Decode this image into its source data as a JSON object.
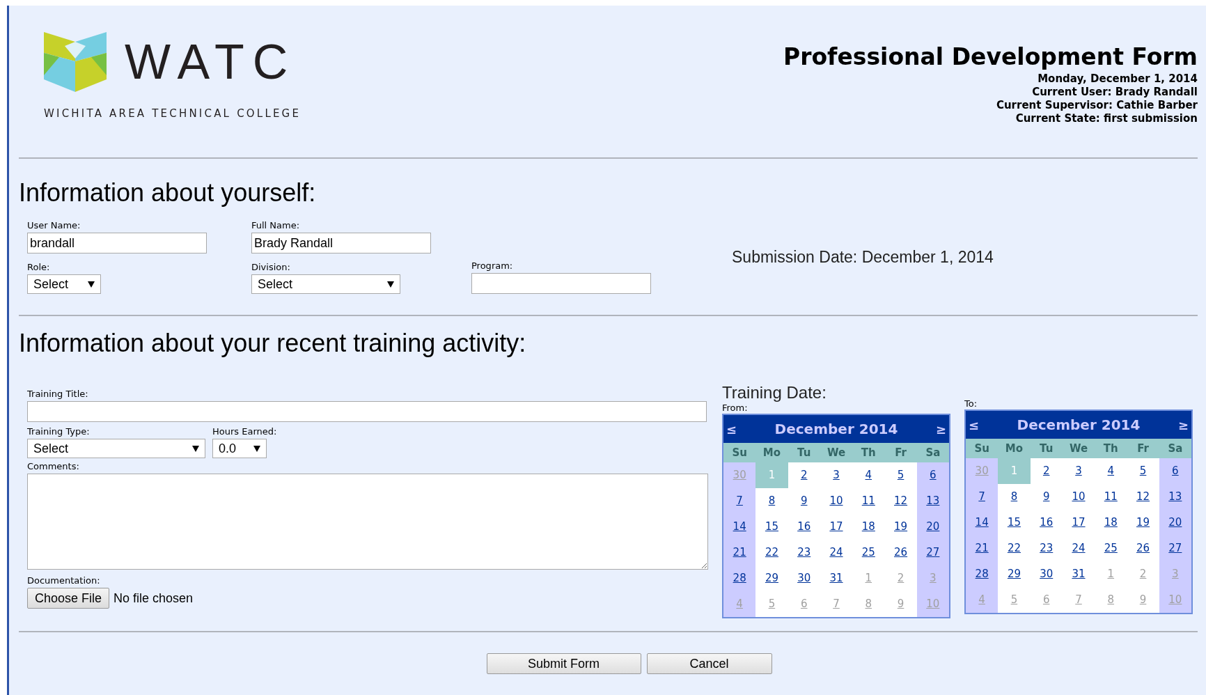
{
  "logo": {
    "wordmark": "WATC",
    "tagline": "WICHITA AREA TECHNICAL COLLEGE"
  },
  "header": {
    "title": "Professional Development Form",
    "lines": [
      "Monday, December 1, 2014",
      "Current User: Brady Randall",
      "Current Supervisor: Cathie Barber",
      "Current State: first submission"
    ]
  },
  "section_1": {
    "heading": "Information about yourself:",
    "user_name": {
      "label": "User Name:",
      "value": "brandall"
    },
    "full_name": {
      "label": "Full Name:",
      "value": "Brady Randall"
    },
    "role": {
      "label": "Role:",
      "value": "Select"
    },
    "division": {
      "label": "Division:",
      "value": "Select"
    },
    "program": {
      "label": "Program:"
    },
    "submission_date": "Submission Date: December 1, 2014"
  },
  "section_2": {
    "heading": "Information about your recent training activity:",
    "training_title": {
      "label": "Training Title:"
    },
    "training_type": {
      "label": "Training Type:",
      "value": "Select"
    },
    "hours_earned": {
      "label": "Hours Earned:",
      "value": "0.0"
    },
    "comments": {
      "label": "Comments:"
    },
    "documentation": {
      "label": "Documentation:",
      "button": "Choose File",
      "status": "No file chosen"
    },
    "training_date": {
      "heading": "Training Date:",
      "calendars": [
        {
          "label": "From:",
          "title": "December 2014",
          "prev": "≤",
          "next": "≥",
          "weekdays": [
            "Su",
            "Mo",
            "Tu",
            "We",
            "Th",
            "Fr",
            "Sa"
          ],
          "weeks": [
            [
              {
                "day": "30",
                "other": true,
                "selected": false
              },
              {
                "day": "1",
                "other": false,
                "selected": true
              },
              {
                "day": "2",
                "other": false,
                "selected": false
              },
              {
                "day": "3",
                "other": false,
                "selected": false
              },
              {
                "day": "4",
                "other": false,
                "selected": false
              },
              {
                "day": "5",
                "other": false,
                "selected": false
              },
              {
                "day": "6",
                "other": false,
                "selected": false
              }
            ],
            [
              {
                "day": "7",
                "other": false,
                "selected": false
              },
              {
                "day": "8",
                "other": false,
                "selected": false
              },
              {
                "day": "9",
                "other": false,
                "selected": false
              },
              {
                "day": "10",
                "other": false,
                "selected": false
              },
              {
                "day": "11",
                "other": false,
                "selected": false
              },
              {
                "day": "12",
                "other": false,
                "selected": false
              },
              {
                "day": "13",
                "other": false,
                "selected": false
              }
            ],
            [
              {
                "day": "14",
                "other": false,
                "selected": false
              },
              {
                "day": "15",
                "other": false,
                "selected": false
              },
              {
                "day": "16",
                "other": false,
                "selected": false
              },
              {
                "day": "17",
                "other": false,
                "selected": false
              },
              {
                "day": "18",
                "other": false,
                "selected": false
              },
              {
                "day": "19",
                "other": false,
                "selected": false
              },
              {
                "day": "20",
                "other": false,
                "selected": false
              }
            ],
            [
              {
                "day": "21",
                "other": false,
                "selected": false
              },
              {
                "day": "22",
                "other": false,
                "selected": false
              },
              {
                "day": "23",
                "other": false,
                "selected": false
              },
              {
                "day": "24",
                "other": false,
                "selected": false
              },
              {
                "day": "25",
                "other": false,
                "selected": false
              },
              {
                "day": "26",
                "other": false,
                "selected": false
              },
              {
                "day": "27",
                "other": false,
                "selected": false
              }
            ],
            [
              {
                "day": "28",
                "other": false,
                "selected": false
              },
              {
                "day": "29",
                "other": false,
                "selected": false
              },
              {
                "day": "30",
                "other": false,
                "selected": false
              },
              {
                "day": "31",
                "other": false,
                "selected": false
              },
              {
                "day": "1",
                "other": true,
                "selected": false
              },
              {
                "day": "2",
                "other": true,
                "selected": false
              },
              {
                "day": "3",
                "other": true,
                "selected": false
              }
            ],
            [
              {
                "day": "4",
                "other": true,
                "selected": false
              },
              {
                "day": "5",
                "other": true,
                "selected": false
              },
              {
                "day": "6",
                "other": true,
                "selected": false
              },
              {
                "day": "7",
                "other": true,
                "selected": false
              },
              {
                "day": "8",
                "other": true,
                "selected": false
              },
              {
                "day": "9",
                "other": true,
                "selected": false
              },
              {
                "day": "10",
                "other": true,
                "selected": false
              }
            ]
          ]
        },
        {
          "label": "To:",
          "title": "December 2014",
          "prev": "≤",
          "next": "≥",
          "weekdays": [
            "Su",
            "Mo",
            "Tu",
            "We",
            "Th",
            "Fr",
            "Sa"
          ],
          "weeks": [
            [
              {
                "day": "30",
                "other": true,
                "selected": false
              },
              {
                "day": "1",
                "other": false,
                "selected": true
              },
              {
                "day": "2",
                "other": false,
                "selected": false
              },
              {
                "day": "3",
                "other": false,
                "selected": false
              },
              {
                "day": "4",
                "other": false,
                "selected": false
              },
              {
                "day": "5",
                "other": false,
                "selected": false
              },
              {
                "day": "6",
                "other": false,
                "selected": false
              }
            ],
            [
              {
                "day": "7",
                "other": false,
                "selected": false
              },
              {
                "day": "8",
                "other": false,
                "selected": false
              },
              {
                "day": "9",
                "other": false,
                "selected": false
              },
              {
                "day": "10",
                "other": false,
                "selected": false
              },
              {
                "day": "11",
                "other": false,
                "selected": false
              },
              {
                "day": "12",
                "other": false,
                "selected": false
              },
              {
                "day": "13",
                "other": false,
                "selected": false
              }
            ],
            [
              {
                "day": "14",
                "other": false,
                "selected": false
              },
              {
                "day": "15",
                "other": false,
                "selected": false
              },
              {
                "day": "16",
                "other": false,
                "selected": false
              },
              {
                "day": "17",
                "other": false,
                "selected": false
              },
              {
                "day": "18",
                "other": false,
                "selected": false
              },
              {
                "day": "19",
                "other": false,
                "selected": false
              },
              {
                "day": "20",
                "other": false,
                "selected": false
              }
            ],
            [
              {
                "day": "21",
                "other": false,
                "selected": false
              },
              {
                "day": "22",
                "other": false,
                "selected": false
              },
              {
                "day": "23",
                "other": false,
                "selected": false
              },
              {
                "day": "24",
                "other": false,
                "selected": false
              },
              {
                "day": "25",
                "other": false,
                "selected": false
              },
              {
                "day": "26",
                "other": false,
                "selected": false
              },
              {
                "day": "27",
                "other": false,
                "selected": false
              }
            ],
            [
              {
                "day": "28",
                "other": false,
                "selected": false
              },
              {
                "day": "29",
                "other": false,
                "selected": false
              },
              {
                "day": "30",
                "other": false,
                "selected": false
              },
              {
                "day": "31",
                "other": false,
                "selected": false
              },
              {
                "day": "1",
                "other": true,
                "selected": false
              },
              {
                "day": "2",
                "other": true,
                "selected": false
              },
              {
                "day": "3",
                "other": true,
                "selected": false
              }
            ],
            [
              {
                "day": "4",
                "other": true,
                "selected": false
              },
              {
                "day": "5",
                "other": true,
                "selected": false
              },
              {
                "day": "6",
                "other": true,
                "selected": false
              },
              {
                "day": "7",
                "other": true,
                "selected": false
              },
              {
                "day": "8",
                "other": true,
                "selected": false
              },
              {
                "day": "9",
                "other": true,
                "selected": false
              },
              {
                "day": "10",
                "other": true,
                "selected": false
              }
            ]
          ]
        }
      ]
    }
  },
  "buttons": [
    "Submit Form",
    "Cancel"
  ]
}
